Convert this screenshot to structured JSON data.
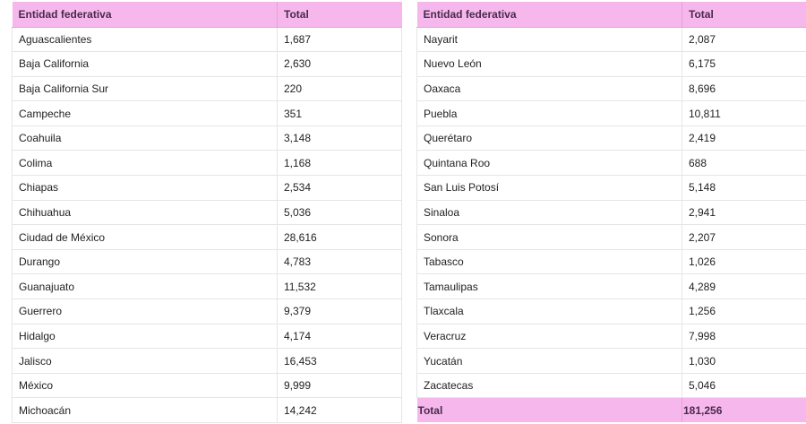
{
  "accent_color": "#f6b8ec",
  "left_table": {
    "headers": [
      "Entidad federativa",
      "Total"
    ],
    "rows": [
      {
        "state": "Aguascalientes",
        "total": "1,687"
      },
      {
        "state": "Baja California",
        "total": "2,630"
      },
      {
        "state": "Baja California Sur",
        "total": "220"
      },
      {
        "state": "Campeche",
        "total": "351"
      },
      {
        "state": "Coahuila",
        "total": "3,148"
      },
      {
        "state": "Colima",
        "total": "1,168"
      },
      {
        "state": "Chiapas",
        "total": "2,534"
      },
      {
        "state": "Chihuahua",
        "total": "5,036"
      },
      {
        "state": "Ciudad de México",
        "total": "28,616"
      },
      {
        "state": "Durango",
        "total": "4,783"
      },
      {
        "state": "Guanajuato",
        "total": "11,532"
      },
      {
        "state": "Guerrero",
        "total": "9,379"
      },
      {
        "state": "Hidalgo",
        "total": "4,174"
      },
      {
        "state": "Jalisco",
        "total": "16,453"
      },
      {
        "state": "México",
        "total": "9,999"
      },
      {
        "state": "Michoacán",
        "total": "14,242"
      }
    ]
  },
  "right_table": {
    "headers": [
      "Entidad federativa",
      "Total"
    ],
    "rows": [
      {
        "state": "Nayarit",
        "total": "2,087"
      },
      {
        "state": "Nuevo León",
        "total": "6,175"
      },
      {
        "state": "Oaxaca",
        "total": "8,696"
      },
      {
        "state": "Puebla",
        "total": "10,811"
      },
      {
        "state": "Querétaro",
        "total": "2,419"
      },
      {
        "state": "Quintana Roo",
        "total": "688"
      },
      {
        "state": "San Luis Potosí",
        "total": "5,148"
      },
      {
        "state": "Sinaloa",
        "total": "2,941"
      },
      {
        "state": "Sonora",
        "total": "2,207"
      },
      {
        "state": "Tabasco",
        "total": "1,026"
      },
      {
        "state": "Tamaulipas",
        "total": "4,289"
      },
      {
        "state": "Tlaxcala",
        "total": "1,256"
      },
      {
        "state": "Veracruz",
        "total": "7,998"
      },
      {
        "state": "Yucatán",
        "total": "1,030"
      },
      {
        "state": "Zacatecas",
        "total": "5,046"
      }
    ],
    "total_row": {
      "label": "Total",
      "value": "181,256"
    }
  }
}
